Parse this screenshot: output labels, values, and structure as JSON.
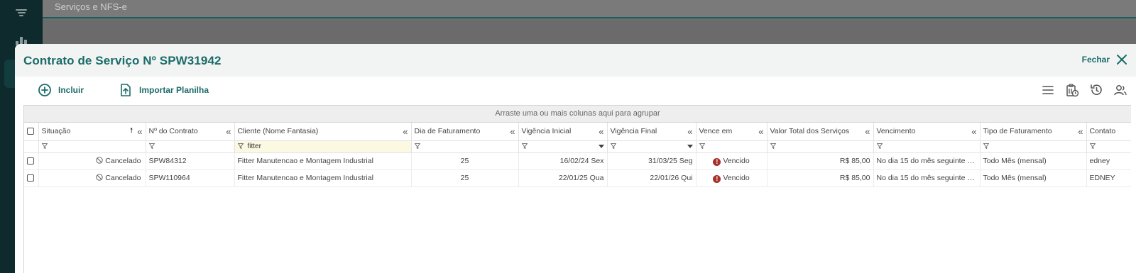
{
  "background": {
    "breadcrumb": "Serviços e NFS-e"
  },
  "modal": {
    "title": "Contrato de Serviço Nº SPW31942",
    "close_label": "Fechar"
  },
  "toolbar": {
    "include_label": "Incluir",
    "import_label": "Importar Planilha",
    "icons": [
      "columns-menu-icon",
      "clipboard-clock-icon",
      "history-icon",
      "users-icon"
    ]
  },
  "grid": {
    "group_panel_text": "Arraste uma ou mais colunas aqui para agrupar",
    "columns": [
      {
        "label": "Situação",
        "sort": "asc"
      },
      {
        "label": "Nº do Contrato"
      },
      {
        "label": "Cliente (Nome Fantasia)"
      },
      {
        "label": "Dia de Faturamento"
      },
      {
        "label": "Vigência Inicial"
      },
      {
        "label": "Vigência Final"
      },
      {
        "label": "Vence em"
      },
      {
        "label": "Valor Total dos Serviços"
      },
      {
        "label": "Vencimento"
      },
      {
        "label": "Tipo de Faturamento"
      },
      {
        "label": "Contato"
      }
    ],
    "filters": {
      "cliente": "fitter"
    },
    "rows": [
      {
        "situacao": "Cancelado",
        "contrato": "SPW84312",
        "cliente": "Fitter Manutencao e Montagem Industrial",
        "dia_faturamento": "25",
        "vigencia_inicial": "16/02/24 Sex",
        "vigencia_final": "31/03/25 Seg",
        "vence_em": "Vencido",
        "valor_total": "R$ 85,00",
        "vencimento": "No dia 15 do mês seguinte ao...",
        "tipo_faturamento": "Todo Mês (mensal)",
        "contato": "edney"
      },
      {
        "situacao": "Cancelado",
        "contrato": "SPW110964",
        "cliente": "Fitter Manutencao e Montagem Industrial",
        "dia_faturamento": "25",
        "vigencia_inicial": "22/01/25 Qua",
        "vigencia_final": "22/01/26 Qui",
        "vence_em": "Vencido",
        "valor_total": "R$ 85,00",
        "vencimento": "No dia 15 do mês seguinte ao...",
        "tipo_faturamento": "Todo Mês (mensal)",
        "contato": "EDNEY"
      }
    ]
  },
  "colors": {
    "accent": "#1b6b68",
    "danger": "#a8302a",
    "filter_active_bg": "#fbf9e1"
  }
}
